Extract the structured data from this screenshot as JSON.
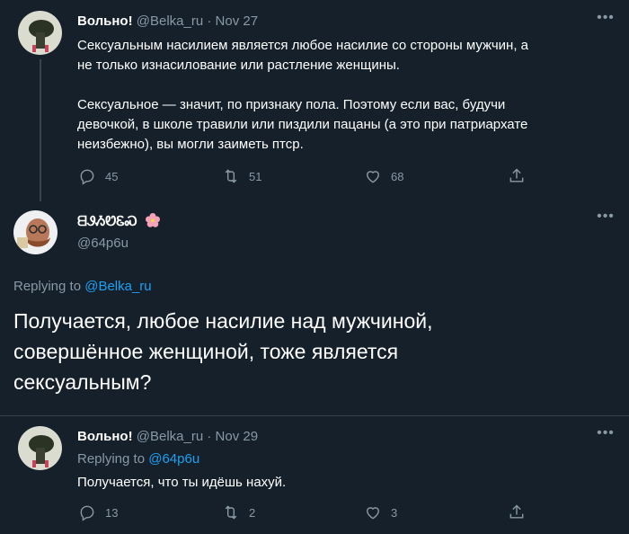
{
  "tweet1": {
    "name": "Вольно!",
    "handle": "@Belka_ru",
    "sep": "·",
    "date": "Nov 27",
    "text": "Сексуальным насилием является любое насилие со стороны мужчин, а\nне только изнасилование или растление женщины.\n\nСексуальное — значит, по признаку пола. Поэтому если вас, будучи\nдевочкой, в школе травили или пиздили пацаны (а это при патриархате\nнеизбежно), вы могли заиметь птср.",
    "replies": "45",
    "retweets": "51",
    "likes": "68"
  },
  "tweet2": {
    "name": "ᗺᏭᏱᏬᏋᏍ",
    "handle": "@64p6u",
    "replying_label": "Replying to",
    "replying_to": "@Belka_ru",
    "text": "Получается, любое насилие над мужчиной,\nсовершённое женщиной, тоже является\nсексуальным?"
  },
  "tweet3": {
    "name": "Вольно!",
    "handle": "@Belka_ru",
    "sep": "·",
    "date": "Nov 29",
    "replying_label": "Replying to",
    "replying_to": "@64p6u",
    "text": "Получается, что ты идёшь нахуй.",
    "replies": "13",
    "retweets": "2",
    "likes": "3"
  },
  "icons": {
    "more": "more-horizontal-icon",
    "reply": "reply-icon",
    "retweet": "retweet-icon",
    "like": "heart-icon",
    "share": "share-icon",
    "flower": "hibiscus-flower-icon"
  },
  "colors": {
    "background": "#15202b",
    "muted": "#8899a6",
    "link": "#1da1f2",
    "divider": "#38444d"
  }
}
